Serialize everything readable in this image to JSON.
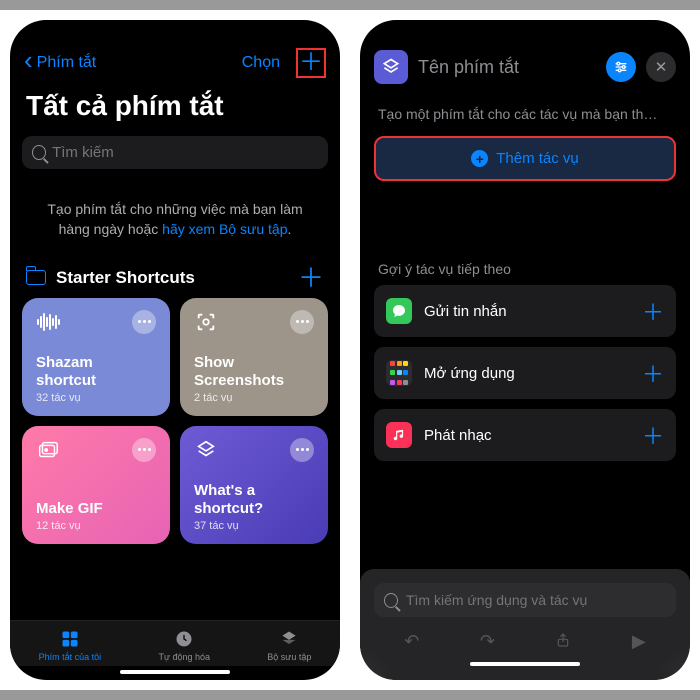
{
  "left": {
    "nav": {
      "back": "Phím tắt",
      "choose": "Chọn"
    },
    "title": "Tất cả phím tắt",
    "search_placeholder": "Tìm kiếm",
    "hint_pre": "Tạo phím tắt cho những việc mà bạn làm hàng ngày hoặc ",
    "hint_link": "hãy xem Bộ sưu tập",
    "hint_post": ".",
    "section": "Starter Shortcuts",
    "cards": [
      {
        "title": "Shazam shortcut",
        "sub": "32 tác vụ"
      },
      {
        "title": "Show Screenshots",
        "sub": "2 tác vụ"
      },
      {
        "title": "Make GIF",
        "sub": "12 tác vụ"
      },
      {
        "title": "What's a shortcut?",
        "sub": "37 tác vụ"
      }
    ],
    "tabs": [
      "Phím tắt của tôi",
      "Tự động hóa",
      "Bộ sưu tập"
    ]
  },
  "right": {
    "title_placeholder": "Tên phím tắt",
    "hint": "Tạo một phím tắt cho các tác vụ mà bạn th…",
    "add_action": "Thêm tác vụ",
    "suggest_label": "Gợi ý tác vụ tiếp theo",
    "suggestions": [
      {
        "label": "Gửi tin nhắn"
      },
      {
        "label": "Mở ứng dụng"
      },
      {
        "label": "Phát nhạc"
      }
    ],
    "bottom_search_placeholder": "Tìm kiếm ứng dụng và tác vụ"
  }
}
